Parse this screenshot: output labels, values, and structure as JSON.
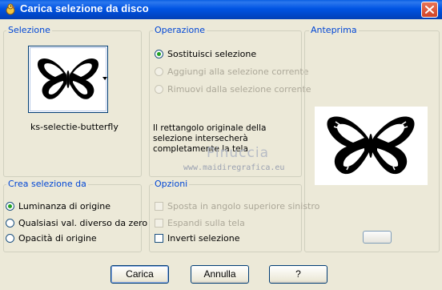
{
  "window": {
    "title": "Carica selezione da disco",
    "icons": {
      "app": "bird-app-icon",
      "close": "close-icon"
    },
    "colors": {
      "accent": "#0046d5",
      "titlebar": "#0054e3",
      "close": "#d24426"
    }
  },
  "selezione": {
    "legend": "Selezione",
    "selection_name": "ks-selectie-butterfly",
    "thumbnail": "butterfly-thumbnail",
    "dropdown_icon": "chevron-down-icon"
  },
  "operazione": {
    "legend": "Operazione",
    "options": [
      {
        "label": "Sostituisci selezione",
        "checked": true,
        "enabled": true
      },
      {
        "label": "Aggiungi alla selezione corrente",
        "checked": false,
        "enabled": false
      },
      {
        "label": "Rimuovi dalla selezione corrente",
        "checked": false,
        "enabled": false
      }
    ],
    "info": "Il rettangolo originale della selezione intersecherà completamente la tela."
  },
  "watermark": {
    "line1": "Pinuccia",
    "line2": "www.maidiregrafica.eu"
  },
  "anteprima": {
    "legend": "Anteprima",
    "image": "butterfly-preview"
  },
  "crea": {
    "legend": "Crea selezione da",
    "options": [
      {
        "label": "Luminanza di origine",
        "checked": true
      },
      {
        "label": "Qualsiasi val. diverso da zero",
        "checked": false
      },
      {
        "label": "Opacità di origine",
        "checked": false
      }
    ]
  },
  "opzioni": {
    "legend": "Opzioni",
    "checkboxes": [
      {
        "label": "Sposta in angolo superiore sinistro",
        "checked": false,
        "enabled": false
      },
      {
        "label": "Espandi sulla tela",
        "checked": false,
        "enabled": false
      },
      {
        "label": "Inverti selezione",
        "checked": false,
        "enabled": true
      }
    ]
  },
  "buttons": {
    "load": "Carica",
    "cancel": "Annulla",
    "help": "?"
  }
}
